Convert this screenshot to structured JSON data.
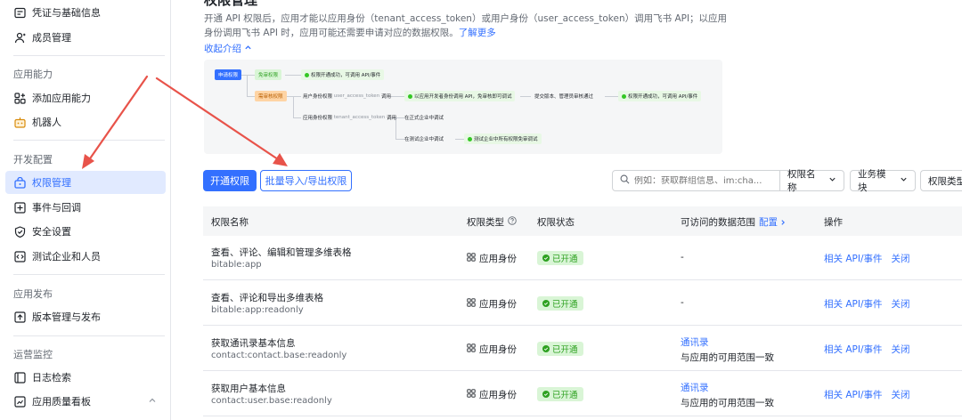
{
  "sidebar": {
    "items": [
      {
        "label": "凭证与基础信息",
        "icon": "credential-icon"
      },
      {
        "label": "成员管理",
        "icon": "member-icon"
      },
      {
        "label": "添加应用能力",
        "icon": "grid-add-icon"
      },
      {
        "label": "机器人",
        "icon": "robot-icon"
      },
      {
        "label": "权限管理",
        "icon": "permission-icon"
      },
      {
        "label": "事件与回调",
        "icon": "event-icon"
      },
      {
        "label": "安全设置",
        "icon": "shield-icon"
      },
      {
        "label": "测试企业和人员",
        "icon": "code-icon"
      },
      {
        "label": "版本管理与发布",
        "icon": "upload-icon"
      },
      {
        "label": "日志检索",
        "icon": "log-icon"
      },
      {
        "label": "应用质量看板",
        "icon": "dashboard-icon"
      }
    ],
    "sections": [
      "应用能力",
      "开发配置",
      "应用发布",
      "运营监控"
    ]
  },
  "main": {
    "title": "权限管理",
    "description": "开通 API 权限后，应用才能以应用身份（tenant_access_token）或用户身份（user_access_token）调用飞书 API；以应用身份调用飞书 API 时，应用可能还需要申请对应的数据权限。",
    "learn_more": "了解更多",
    "collapse": "收起介绍"
  },
  "flow": {
    "apply": "申请权限",
    "no_review": "免审权限",
    "no_review_result": "权限开通成功，可调用 API/事件",
    "need_review": "需审核权限",
    "user_identity": "用户身份权限",
    "user_token": "user_access_token",
    "invoke": "调用",
    "user_dev_result": "以应用开发者身份调用 API，免审核即可调试",
    "submit": "提交版本、管理员审核通过",
    "final_result": "权限开通成功，可调用 API/事件",
    "app_identity": "应用身份权限",
    "tenant_token": "tenant_access_token",
    "prod_debug": "在正式企业中调试",
    "test_debug": "在测试企业中调试",
    "test_result": "测试企业中所有权限免审调试"
  },
  "toolbar": {
    "enable_btn": "开通权限",
    "batch_btn": "批量导入/导出权限",
    "search_placeholder": "例如：获取群组信息、im:cha...",
    "filter_name": "权限名称",
    "filter_module": "业务模块",
    "filter_type": "权限类型"
  },
  "table": {
    "headers": {
      "name": "权限名称",
      "type": "权限类型",
      "status": "权限状态",
      "scope": "可访问的数据范围",
      "scope_config": "配置",
      "actions": "操作"
    },
    "rows": [
      {
        "name": "查看、评论、编辑和管理多维表格",
        "code": "bitable:app",
        "type": "应用身份",
        "status": "已开通",
        "scope": "-",
        "scope_link": "",
        "scope_text": "",
        "action1": "相关 API/事件",
        "action2": "关闭"
      },
      {
        "name": "查看、评论和导出多维表格",
        "code": "bitable:app:readonly",
        "type": "应用身份",
        "status": "已开通",
        "scope": "-",
        "scope_link": "",
        "scope_text": "",
        "action1": "相关 API/事件",
        "action2": "关闭"
      },
      {
        "name": "获取通讯录基本信息",
        "code": "contact:contact.base:readonly",
        "type": "应用身份",
        "status": "已开通",
        "scope": "",
        "scope_link": "通讯录",
        "scope_text": "与应用的可用范围一致",
        "action1": "相关 API/事件",
        "action2": "关闭"
      },
      {
        "name": "获取用户基本信息",
        "code": "contact:user.base:readonly",
        "type": "应用身份",
        "status": "已开通",
        "scope": "",
        "scope_link": "通讯录",
        "scope_text": "与应用的可用范围一致",
        "action1": "相关 API/事件",
        "action2": "关闭"
      }
    ]
  },
  "colors": {
    "accent": "#3370ff",
    "success": "#2ea121",
    "annotation": "#e8534a"
  }
}
